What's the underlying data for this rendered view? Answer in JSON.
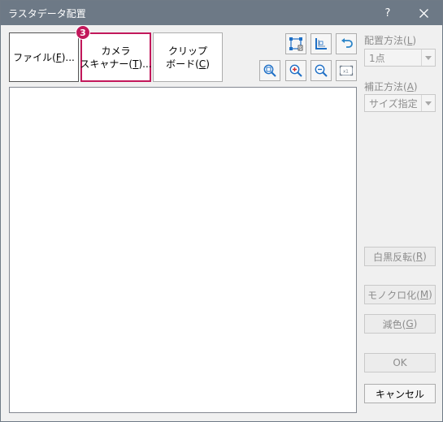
{
  "window": {
    "title": "ラスタデータ配置",
    "help_glyph": "?",
    "close_glyph": "✕"
  },
  "source_buttons": {
    "file": {
      "label": "ファイル(",
      "accel": "F",
      "label_end": ")..."
    },
    "camera": {
      "line1": "カメラ",
      "line2": "スキャナー(",
      "accel": "T",
      "line2_end": ")..."
    },
    "clipboard": {
      "line1": "クリップ",
      "line2": "ボード(",
      "accel": "C",
      "line2_end": ")"
    }
  },
  "step_badge": "3",
  "toolbar_icons": [
    "placement-points-icon",
    "corner-icon",
    "undo-icon",
    "zoom-fit-icon",
    "zoom-in-icon",
    "zoom-out-icon",
    "actual-size-icon"
  ],
  "placement": {
    "label": "配置方法(",
    "accel": "L",
    "label_end": ")",
    "value": "1点"
  },
  "correction": {
    "label": "補正方法(",
    "accel": "A",
    "label_end": ")",
    "value": "サイズ指定"
  },
  "buttons": {
    "invert": {
      "label": "白黒反転(",
      "accel": "R",
      "label_end": ")"
    },
    "mono": {
      "label": "モノクロ化(",
      "accel": "M",
      "label_end": ")"
    },
    "reduce": {
      "label": "減色(",
      "accel": "G",
      "label_end": ")"
    },
    "ok": "OK",
    "cancel": "キャンセル"
  },
  "colors": {
    "titlebar": "#6d7986",
    "highlight": "#c2185b",
    "icon_blue": "#1e6fc6"
  }
}
